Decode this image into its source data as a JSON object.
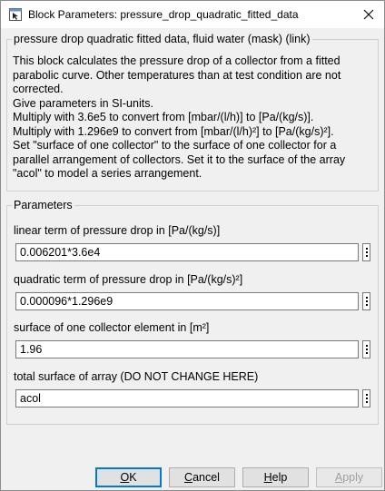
{
  "window": {
    "title": "Block Parameters: pressure_drop_quadratic_fitted_data"
  },
  "icons": {
    "app": "block-parameters-icon",
    "close": "close-icon"
  },
  "description_group": {
    "legend": "pressure drop quadratic fitted data, fluid water (mask) (link)",
    "lines": [
      "This block calculates the pressure drop of a collector from a fitted",
      "parabolic curve. Other temperatures than at test condition are not",
      "corrected.",
      "Give parameters in SI-units.",
      "Multiply with 3.6e5 to convert from [mbar/(l/h)] to [Pa/(kg/s)].",
      "Multiply with 1.296e9 to convert from [mbar/(l/h)²] to [Pa/(kg/s)²].",
      "Set \"surface of one collector\" to the surface of one collector for a",
      "parallel arrangement of collectors. Set it to the surface of the array",
      "\"acol\" to model a series arrangement."
    ]
  },
  "parameters_group": {
    "legend": "Parameters",
    "params": [
      {
        "label": "linear term of pressure drop in [Pa/(kg/s)]",
        "value": "0.006201*3.6e4"
      },
      {
        "label": "quadratic term of pressure drop in [Pa/(kg/s)²]",
        "value": "0.000096*1.296e9"
      },
      {
        "label": "surface of one collector element in [m²]",
        "value": "1.96"
      },
      {
        "label": "total surface of array (DO NOT CHANGE HERE)",
        "value": "acol"
      }
    ]
  },
  "buttons": {
    "ok": {
      "mnemonic": "O",
      "rest": "K"
    },
    "cancel": {
      "mnemonic": "C",
      "rest": "ancel"
    },
    "help": {
      "mnemonic": "H",
      "rest": "elp"
    },
    "apply": {
      "mnemonic": "A",
      "rest": "pply"
    }
  }
}
